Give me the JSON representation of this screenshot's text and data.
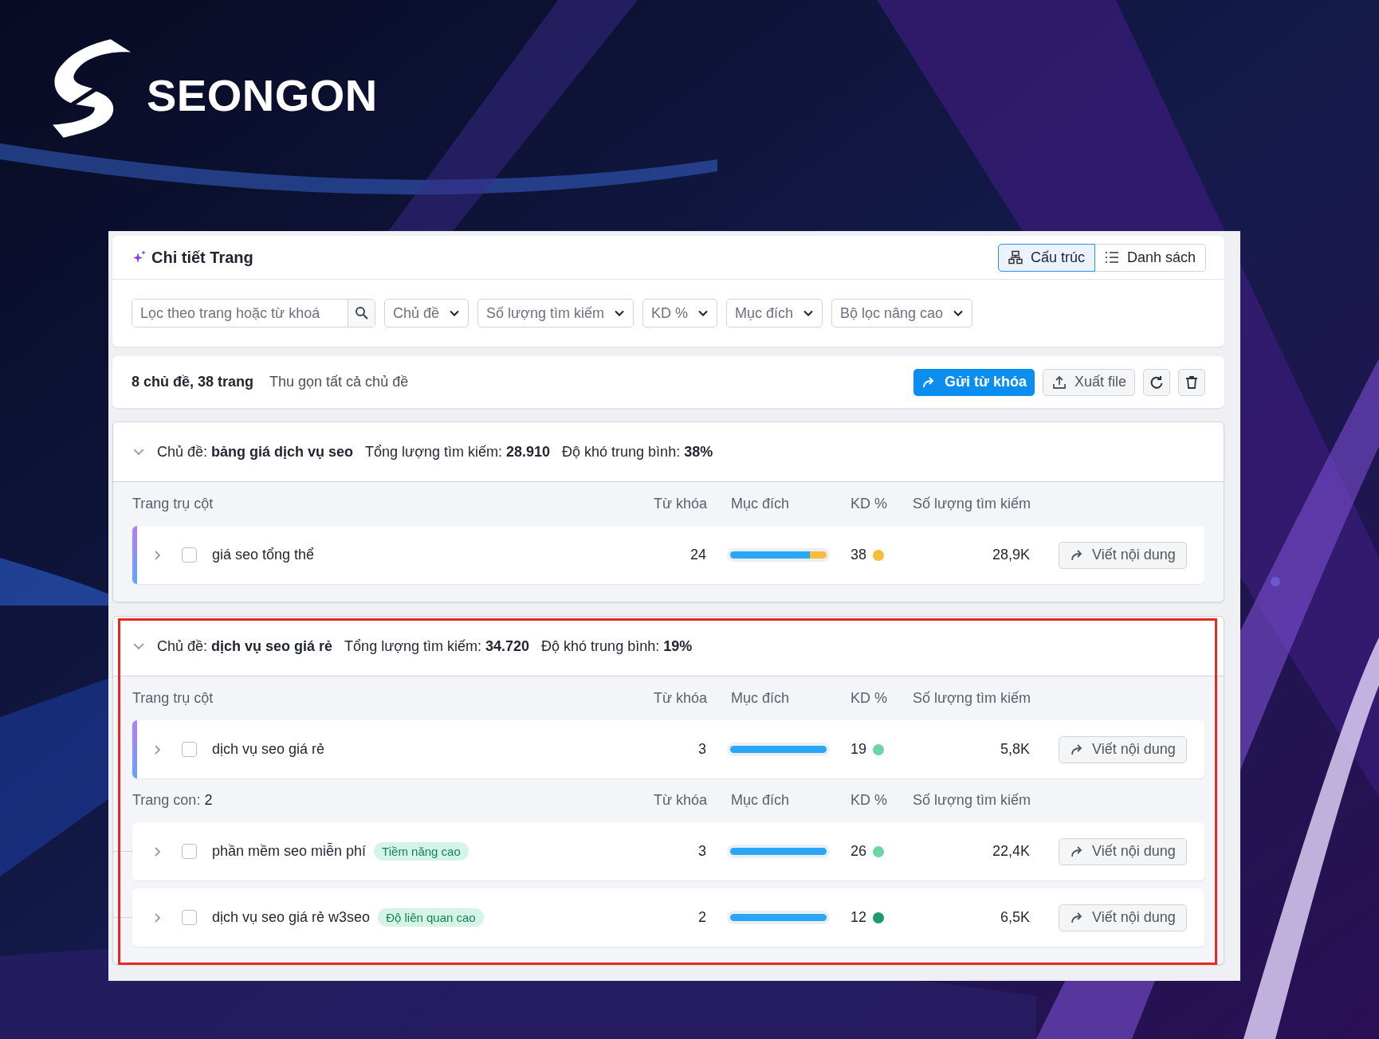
{
  "brand": {
    "name": "SEONGON"
  },
  "panel": {
    "title": "Chi tiết Trang",
    "views": [
      {
        "label": "Cấu trúc",
        "kind": "tree",
        "selected": true
      },
      {
        "label": "Danh sách",
        "kind": "list",
        "selected": false
      }
    ],
    "search": {
      "placeholder": "Lọc theo trang hoặc từ khoá"
    },
    "filters": [
      "Chủ đề",
      "Số lượng tìm kiếm",
      "KD %",
      "Mục đích",
      "Bộ lọc nâng cao"
    ],
    "summary": "8 chủ đề, 38 trang",
    "collapse_link": "Thu gọn tất cả chủ đề",
    "actions": [
      {
        "kind": "send",
        "label": "Gửi từ khóa"
      },
      {
        "kind": "export",
        "label": "Xuất file"
      },
      {
        "kind": "refresh"
      },
      {
        "kind": "delete"
      }
    ]
  },
  "topics": [
    {
      "expanded": true,
      "highlighted": false,
      "stats": [
        "Chủ đề: **bảng giá dịch vụ seo**",
        "Tổng lượng tìm kiếm: **28.910**",
        "Độ khó trung bình: **38%**"
      ],
      "groups": [
        {
          "label": "Trang trụ cột",
          "columns": [
            "Từ khóa",
            "Mục đích",
            "KD %",
            "Số lượng tìm kiếm"
          ],
          "rows": [
            {
              "kind": "pillar",
              "expanded": false,
              "checked": false,
              "title": "giá seo tổng thể",
              "keywords": "24",
              "intent": [
                {
                  "level": 0.83,
                  "color": "#2aa7f4"
                },
                {
                  "level": 0.17,
                  "color": "#f7bd3a"
                }
              ],
              "kd": "38",
              "color": "#f7bd3a",
              "volume": "28,9K",
              "action": "Viết nội dung"
            }
          ]
        }
      ]
    },
    {
      "expanded": true,
      "highlighted": true,
      "stats": [
        "Chủ đề: **dịch vụ seo giá rẻ**",
        "Tổng lượng tìm kiếm: **34.720**",
        "Độ khó trung bình: **19%**"
      ],
      "groups": [
        {
          "label": "Trang trụ cột",
          "columns": [
            "Từ khóa",
            "Mục đích",
            "KD %",
            "Số lượng tìm kiếm"
          ],
          "rows": [
            {
              "kind": "pillar",
              "expanded": false,
              "checked": false,
              "title": "dịch vụ seo giá rẻ",
              "keywords": "3",
              "intent": [
                {
                  "level": 1,
                  "color": "#2aa7f4"
                }
              ],
              "kd": "19",
              "color": "#6dd4a4",
              "volume": "5,8K",
              "action": "Viết nội dung"
            }
          ]
        },
        {
          "label": "Trang con: **2**",
          "columns": [
            "Từ khóa",
            "Mục đích",
            "KD %",
            "Số lượng tìm kiếm"
          ],
          "rows": [
            {
              "kind": "child",
              "expanded": false,
              "checked": false,
              "title": "phần mềm seo miễn phí",
              "tag": "Tiềm năng cao",
              "keywords": "3",
              "intent": [
                {
                  "level": 1,
                  "color": "#2aa7f4"
                }
              ],
              "kd": "26",
              "color": "#6dd4a4",
              "volume": "22,4K",
              "action": "Viết nội dung"
            },
            {
              "kind": "child",
              "expanded": false,
              "checked": false,
              "title": "dịch vụ seo giá rẻ w3seo",
              "tag": "Độ liên quan cao",
              "keywords": "2",
              "intent": [
                {
                  "level": 1,
                  "color": "#2aa7f4"
                }
              ],
              "kd": "12",
              "color": "#1f9a6c",
              "volume": "6,5K",
              "action": "Viết nội dung"
            }
          ]
        }
      ]
    }
  ]
}
